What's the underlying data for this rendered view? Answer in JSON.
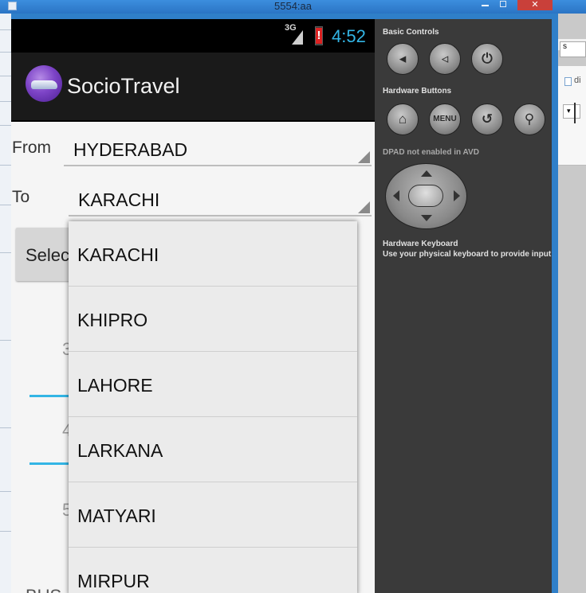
{
  "window": {
    "title": "5554:aa",
    "close_label": "✕"
  },
  "status_bar": {
    "network": "3G",
    "battery_alert": "!",
    "time": "4:52"
  },
  "app": {
    "title": "SocioTravel"
  },
  "form": {
    "from_label": "From",
    "from_value": "HYDERABAD",
    "to_label": "To",
    "to_value": "KARACHI",
    "select_button_label": "Select",
    "background_hints": [
      "3",
      "4",
      "5",
      "BUS"
    ]
  },
  "dropdown": {
    "options": [
      "KARACHI",
      "KHIPRO",
      "LAHORE",
      "LARKANA",
      "MATYARI",
      "MIRPUR"
    ]
  },
  "controls": {
    "basic_controls_label": "Basic Controls",
    "hardware_buttons_label": "Hardware Buttons",
    "menu_label": "MENU",
    "dpad_label": "DPAD not enabled in AVD",
    "keyboard_title": "Hardware Keyboard",
    "keyboard_hint": "Use your physical keyboard to provide input"
  },
  "background_window": {
    "field_text": "s",
    "doc_label": "di"
  },
  "colors": {
    "accent": "#33b5e5",
    "chrome": "#2f7fc9",
    "close": "#c9403a"
  }
}
